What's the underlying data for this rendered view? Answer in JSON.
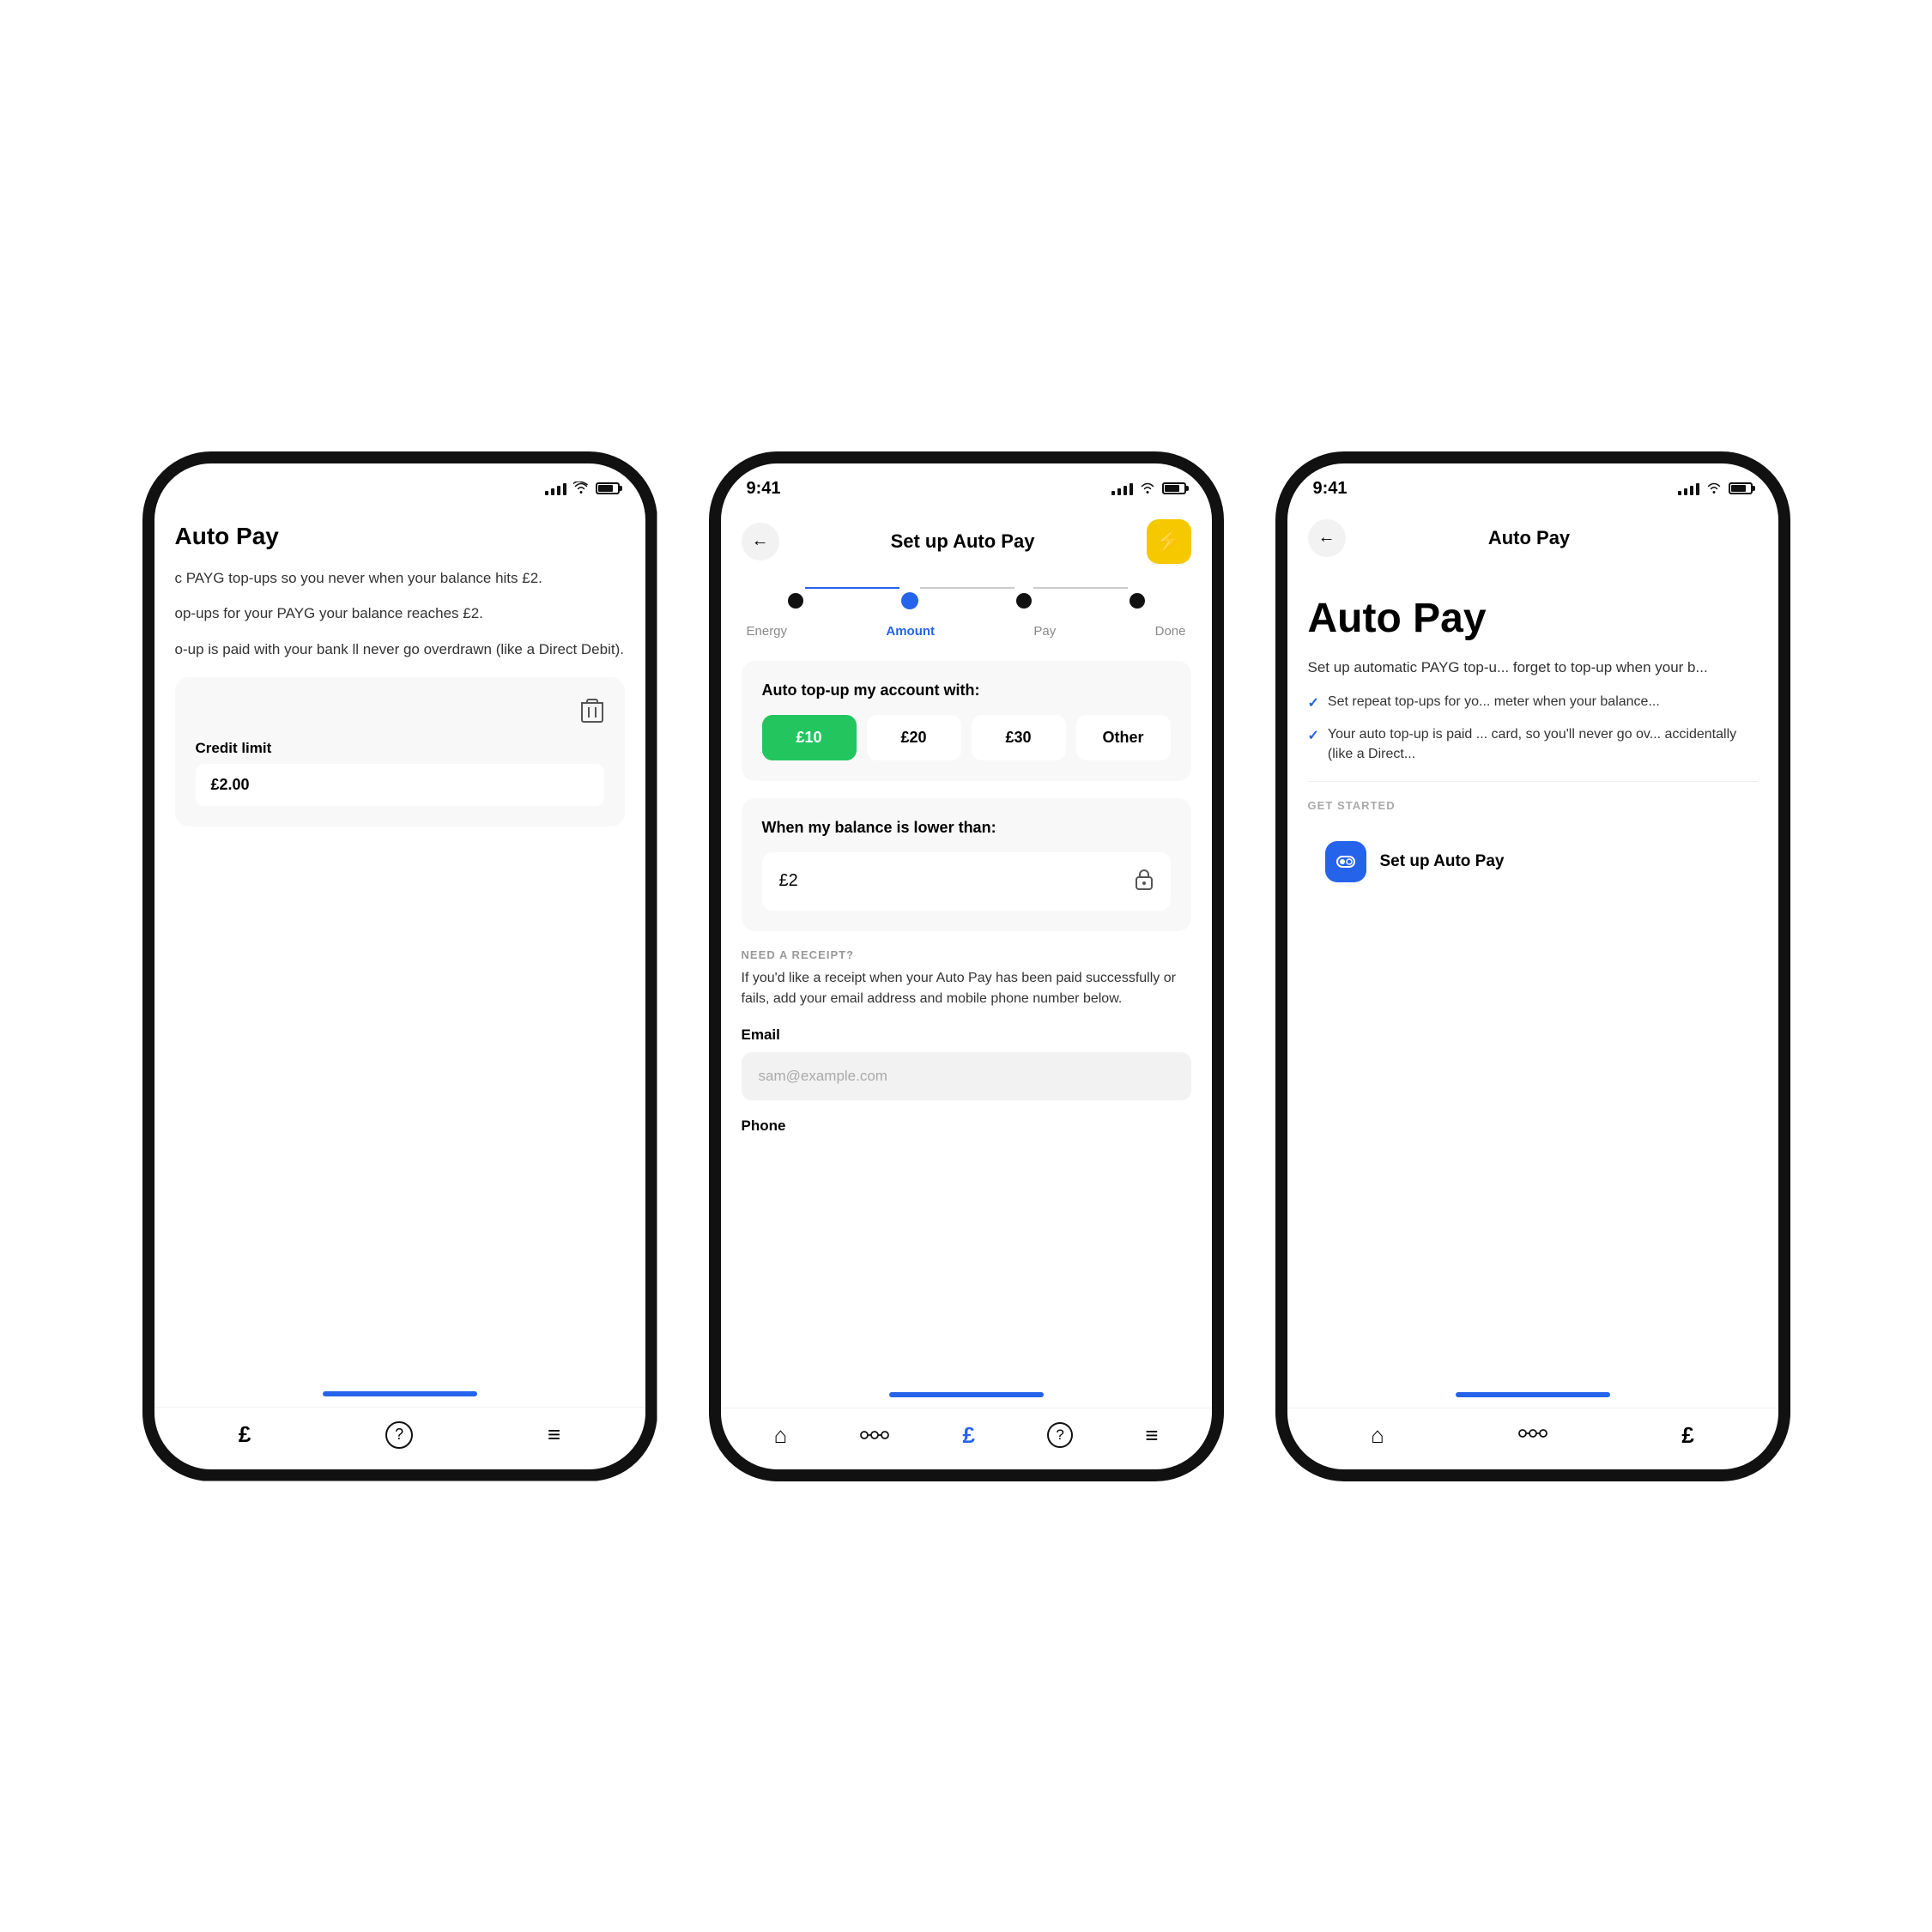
{
  "colors": {
    "blue": "#2563eb",
    "green": "#22c55e",
    "yellow": "#f5c800",
    "gray_bg": "#f8f8f8",
    "light_gray": "#f2f2f2",
    "text_dark": "#111",
    "text_mid": "#333",
    "text_light": "#888",
    "bottom_bar": "#38bdf8"
  },
  "left_phone": {
    "title": "Auto Pay",
    "description1": "c PAYG top-ups so you never when your balance hits £2.",
    "description2": "op-ups for your PAYG your balance reaches £2.",
    "description3": "o-up is paid with your bank ll never go overdrawn (like a Direct Debit).",
    "credit_section": {
      "credit_limit_label": "Credit limit",
      "credit_limit_value": "£2.00"
    },
    "bottom_nav": [
      {
        "icon": "£",
        "label": "pay"
      },
      {
        "icon": "?",
        "label": "help"
      },
      {
        "icon": "≡",
        "label": "menu"
      }
    ]
  },
  "middle_phone": {
    "status_time": "9:41",
    "header": {
      "back_label": "←",
      "title": "Set up Auto Pay",
      "action_icon": "⚡"
    },
    "stepper": {
      "steps": [
        {
          "label": "Energy",
          "state": "completed"
        },
        {
          "label": "Amount",
          "state": "active"
        },
        {
          "label": "Pay",
          "state": "default"
        },
        {
          "label": "Done",
          "state": "default"
        }
      ]
    },
    "amount_section": {
      "title": "Auto top-up my account with:",
      "options": [
        {
          "value": "£10",
          "selected": true
        },
        {
          "value": "£20",
          "selected": false
        },
        {
          "value": "£30",
          "selected": false
        },
        {
          "value": "Other",
          "selected": false
        }
      ]
    },
    "balance_section": {
      "title": "When my balance is lower than:",
      "value": "£2",
      "locked": true
    },
    "receipt_section": {
      "label": "NEED A RECEIPT?",
      "description": "If you'd like a receipt when your Auto Pay has been paid successfully or fails, add your email address and mobile phone number below.",
      "email_label": "Email",
      "email_placeholder": "sam@example.com",
      "phone_label": "Phone"
    },
    "bottom_nav": [
      {
        "icon": "⌂",
        "label": "home"
      },
      {
        "icon": "⬡",
        "label": "energy"
      },
      {
        "icon": "£",
        "label": "pay"
      },
      {
        "icon": "?",
        "label": "help"
      },
      {
        "icon": "≡",
        "label": "menu"
      }
    ]
  },
  "right_phone": {
    "status_time": "9:41",
    "header": {
      "back_label": "←",
      "title": "Auto Pay"
    },
    "page_title": "Auto Pay",
    "description": "Set up automatic PAYG top-u... forget to top-up when your b...",
    "features": [
      "Set repeat top-ups for yo... meter when your balance...",
      "Your auto top-up is paid ... card, so you'll never go ov... accidentally (like a Direct..."
    ],
    "get_started_label": "GET STARTED",
    "setup_btn_label": "Set up Auto Pay",
    "bottom_nav": [
      {
        "icon": "⌂",
        "label": "home"
      },
      {
        "icon": "⬡",
        "label": "energy"
      },
      {
        "icon": "£",
        "label": "pay"
      }
    ]
  }
}
